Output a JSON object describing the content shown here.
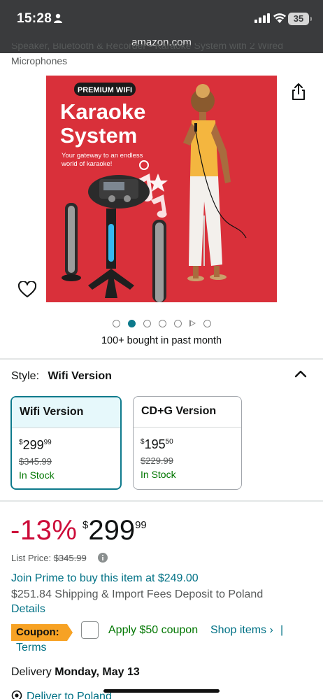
{
  "status_bar": {
    "time": "15:28",
    "battery": "35"
  },
  "browser": {
    "url": "amazon.com"
  },
  "product": {
    "title_cut_line1": "Speaker, Bluetooth & Recorder - Karaoke System with 2 Wired",
    "title_cut_line2": "Microphones",
    "image": {
      "badge": "PREMIUM WIFI",
      "headline_1": "Karaoke",
      "headline_2": "System",
      "tagline_1": "Your gateway to an endless",
      "tagline_2": "world of karaoke!",
      "background_color": "#d9303a"
    },
    "bought": "100+ bought in past month"
  },
  "style_selector": {
    "label": "Style:",
    "selected": "Wifi Version",
    "options": [
      {
        "name": "Wifi Version",
        "price_whole": "299",
        "price_frac": "99",
        "list_price": "$345.99",
        "stock": "In Stock",
        "selected": true
      },
      {
        "name": "CD+G Version",
        "price_whole": "195",
        "price_frac": "50",
        "list_price": "$229.99",
        "stock": "In Stock",
        "selected": false
      }
    ]
  },
  "pricing": {
    "discount": "-13%",
    "currency": "$",
    "whole": "299",
    "fraction": "99",
    "list_price_label": "List Price:",
    "list_price": "$345.99",
    "prime_offer": "Join Prime to buy this item at $249.00",
    "shipping": "$251.84 Shipping & Import Fees Deposit to Poland",
    "details_link": "Details"
  },
  "coupon": {
    "badge": "Coupon:",
    "apply": "Apply $50 coupon",
    "shop_items": "Shop items ›",
    "separator": "|",
    "terms": "Terms"
  },
  "delivery": {
    "prefix": "Delivery",
    "date": "Monday, May 13",
    "deliver_to": "Deliver to Poland"
  },
  "colors": {
    "accent_teal": "#0d7a8c",
    "link": "#007185",
    "discount_red": "#cc0c39",
    "in_stock_green": "#007600",
    "coupon_orange": "#f7a224"
  },
  "carousel": {
    "count": 7,
    "active_index": 1,
    "video_index": 5
  }
}
